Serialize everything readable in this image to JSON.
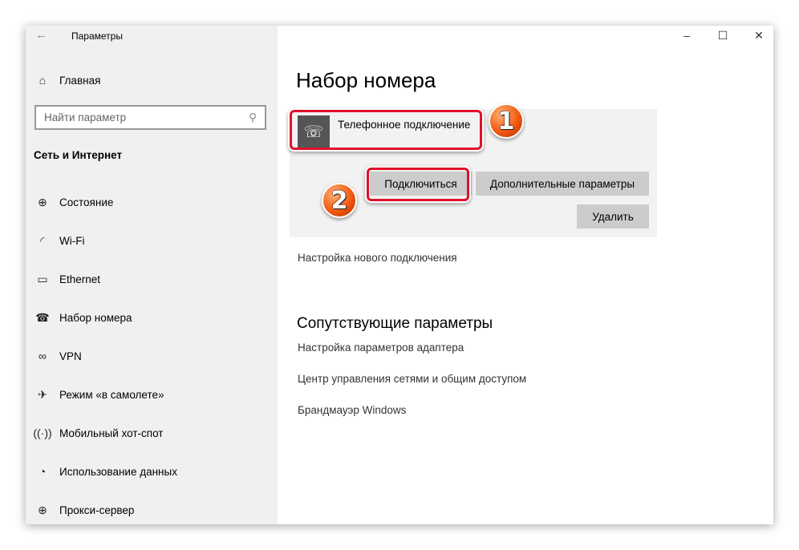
{
  "window": {
    "title": "Параметры",
    "minimize_icon": "minimize-icon",
    "maximize_icon": "maximize-icon",
    "close_icon": "close-icon"
  },
  "sidebar": {
    "home": "Главная",
    "search_placeholder": "Найти параметр",
    "section": "Сеть и Интернет",
    "items": [
      {
        "label": "Состояние",
        "icon": "globe-icon"
      },
      {
        "label": "Wi-Fi",
        "icon": "wifi-icon"
      },
      {
        "label": "Ethernet",
        "icon": "ethernet-icon"
      },
      {
        "label": "Набор номера",
        "icon": "dialup-icon"
      },
      {
        "label": "VPN",
        "icon": "vpn-icon"
      },
      {
        "label": "Режим «в самолете»",
        "icon": "airplane-icon"
      },
      {
        "label": "Мобильный хот-спот",
        "icon": "hotspot-icon"
      },
      {
        "label": "Использование данных",
        "icon": "data-usage-icon"
      },
      {
        "label": "Прокси-сервер",
        "icon": "globe-icon"
      }
    ]
  },
  "main": {
    "title": "Набор номера",
    "connection_name": "Телефонное подключение",
    "connect": "Подключиться",
    "advanced": "Дополнительные параметры",
    "delete": "Удалить",
    "new_connection": "Настройка нового подключения",
    "related_title": "Сопутствующие параметры",
    "related": [
      "Настройка параметров адаптера",
      "Центр управления сетями и общим доступом",
      "Брандмауэр Windows"
    ]
  },
  "annotations": {
    "one": "1",
    "two": "2",
    "color": "#e0102a"
  }
}
